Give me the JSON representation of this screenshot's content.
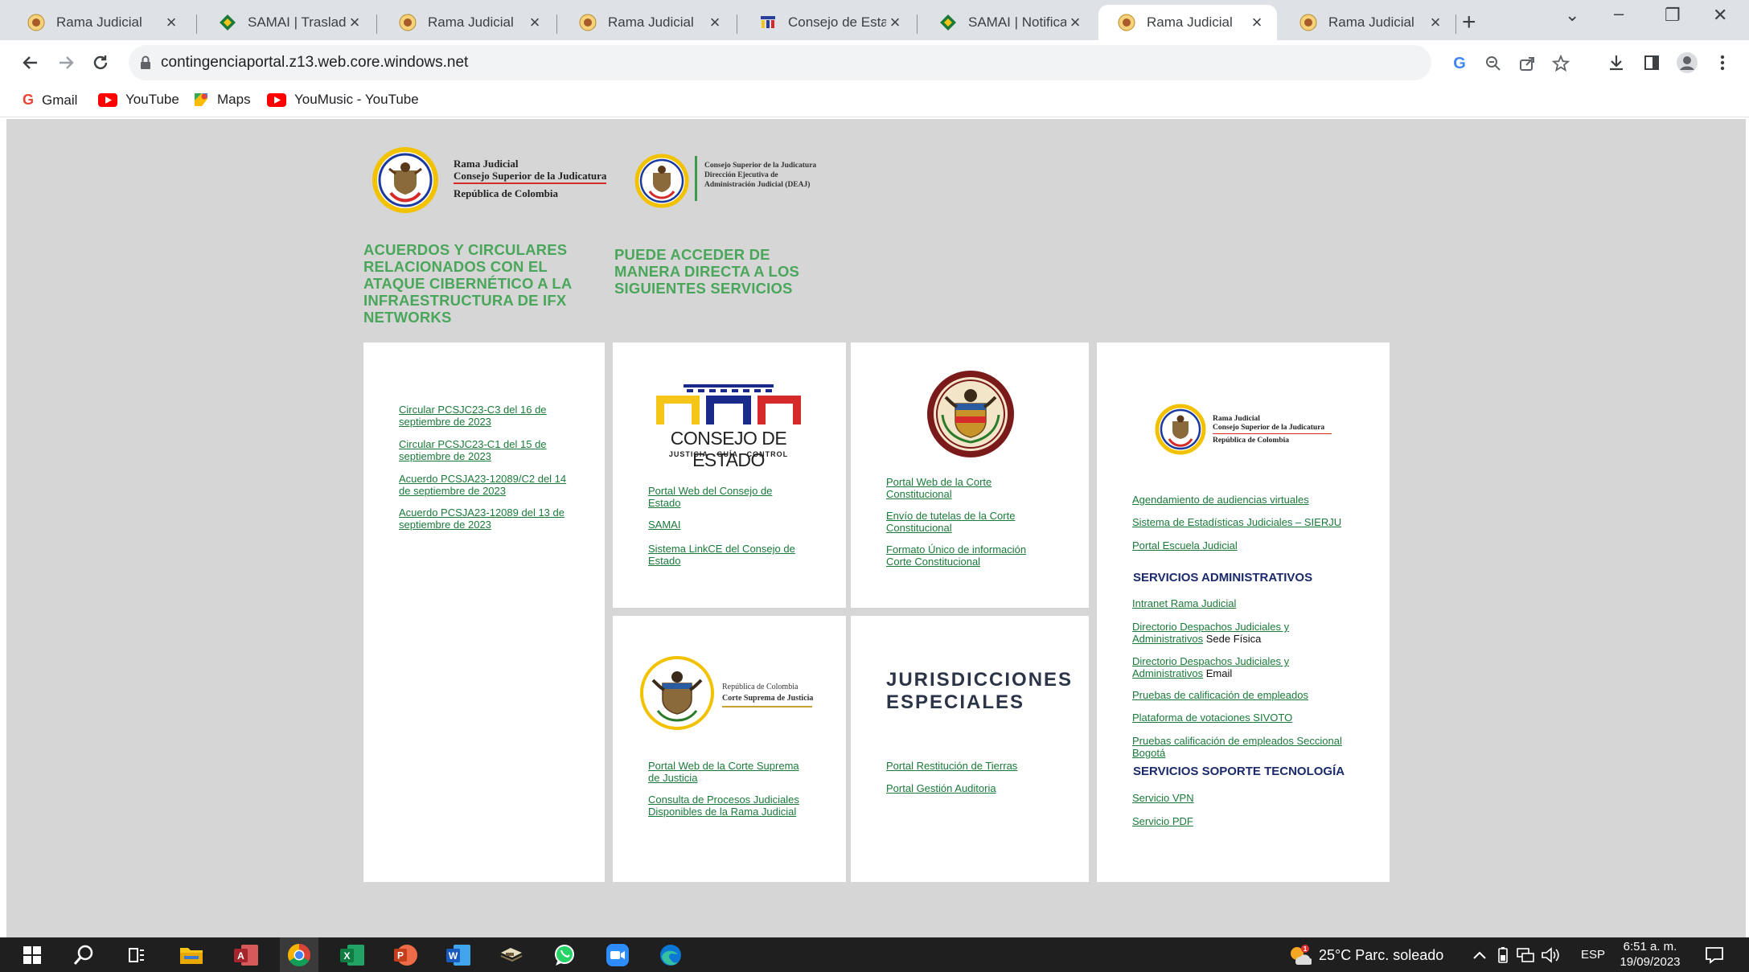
{
  "browser": {
    "tabs": [
      {
        "title": "Rama Judicial",
        "favicon": "seal-icon"
      },
      {
        "title": "SAMAI | Traslados",
        "favicon": "samai-icon"
      },
      {
        "title": "Rama Judicial",
        "favicon": "seal-icon"
      },
      {
        "title": "Rama Judicial",
        "favicon": "seal-icon"
      },
      {
        "title": "Consejo de Estado",
        "favicon": "consejo-icon"
      },
      {
        "title": "SAMAI | Notificacio",
        "favicon": "samai-icon"
      },
      {
        "title": "Rama Judicial",
        "favicon": "seal-icon",
        "active": true
      },
      {
        "title": "Rama Judicial",
        "favicon": "seal-icon"
      }
    ],
    "url": "contingenciaportal.z13.web.core.windows.net",
    "bookmarks": [
      {
        "label": "Gmail",
        "icon": "google-icon"
      },
      {
        "label": "YouTube",
        "icon": "youtube-icon"
      },
      {
        "label": "Maps",
        "icon": "maps-icon"
      },
      {
        "label": "YouMusic - YouTube",
        "icon": "youtube-icon"
      }
    ]
  },
  "page": {
    "logo1": {
      "line1": "Rama Judicial",
      "line2": "Consejo Superior de la Judicatura",
      "line3": "República de Colombia"
    },
    "logo2": {
      "line1": "Consejo Superior de la Judicatura",
      "line2": "Dirección Ejecutiva de",
      "line3": "Administración Judicial (DEAJ)"
    },
    "heading_left": "ACUERDOS Y CIRCULARES RELACIONADOS CON EL ATAQUE CIBERNÉTICO A LA INFRAESTRUCTURA DE IFX NETWORKS",
    "heading_right": "PUEDE ACCEDER DE MANERA DIRECTA A LOS SIGUIENTES SERVICIOS",
    "acuerdos": [
      "Circular PCSJC23-C3 del 16 de septiembre de 2023",
      "Circular PCSJC23-C1 del 15 de septiembre de 2023",
      "Acuerdo PCSJA23-12089/C2 del 14 de septiembre de 2023",
      "Acuerdo PCSJA23-12089 del 13 de septiembre de 2023"
    ],
    "consejo": {
      "logo_title": "CONSEJO DE ESTADO",
      "logo_sub": "JUSTICIA · GUÍA · CONTROL",
      "links": [
        "Portal Web del Consejo de Estado",
        "SAMAI",
        "Sistema LinkCE del Consejo de Estado"
      ]
    },
    "corte_constitucional": {
      "seal_text": "CORTE CONSTITUCIONAL · REPÚBLICA DE COLOMBIA",
      "links": [
        "Portal Web de la Corte Constitucional",
        "Envío de tutelas de la Corte Constitucional",
        "Formato Único de información Corte Constitucional"
      ]
    },
    "rama": {
      "logo": {
        "line1": "Rama Judicial",
        "line2": "Consejo Superior de la Judicatura",
        "line3": "República de Colombia"
      },
      "links": [
        "Agendamiento de audiencias virtuales",
        "Sistema de Estadísticas Judiciales – SIERJU",
        "Portal Escuela Judicial"
      ],
      "admin_heading": "SERVICIOS ADMINISTRATIVOS",
      "admin_links": [
        {
          "link": "Intranet Rama Judicial",
          "suffix": ""
        },
        {
          "link": "Directorio Despachos Judiciales y Administrativos",
          "suffix": " Sede Física"
        },
        {
          "link": "Directorio Despachos Judiciales y Administrativos",
          "suffix": " Email"
        },
        {
          "link": "Pruebas de calificación de empleados",
          "suffix": ""
        },
        {
          "link": "Plataforma de votaciones SIVOTO",
          "suffix": ""
        },
        {
          "link": "Pruebas calificación de empleados Seccional Bogotá",
          "suffix": ""
        }
      ],
      "tech_heading": "SERVICIOS SOPORTE TECNOLOGÍA",
      "tech_links": [
        "Servicio VPN",
        "Servicio PDF"
      ]
    },
    "corte_suprema": {
      "logo": {
        "line1": "República de Colombia",
        "line2": "Corte Suprema de Justicia"
      },
      "links": [
        "Portal Web de la Corte Suprema de Justicia",
        "Consulta de Procesos Judiciales Disponibles de la Rama Judicial"
      ]
    },
    "jurisdicciones": {
      "title1": "JURISDICCIONES",
      "title2": "ESPECIALES",
      "links": [
        "Portal Restitución de Tierras",
        "Portal Gestión Auditoria"
      ]
    }
  },
  "taskbar": {
    "weather": "25°C  Parc. soleado",
    "lang": "ESP",
    "time": "6:51 a. m.",
    "date": "19/09/2023",
    "apps": [
      "windows-start-icon",
      "search-icon",
      "task-view-icon",
      "file-explorer-icon",
      "access-icon",
      "chrome-icon",
      "excel-icon",
      "powerpoint-icon",
      "word-icon",
      "app-icon",
      "whatsapp-icon",
      "zoom-icon",
      "edge-icon"
    ]
  },
  "colors": {
    "accent_green": "#4aa65a",
    "link_green": "#1a7a3a",
    "navy": "#1a2a6c",
    "page_bg": "#d6d6d6"
  }
}
